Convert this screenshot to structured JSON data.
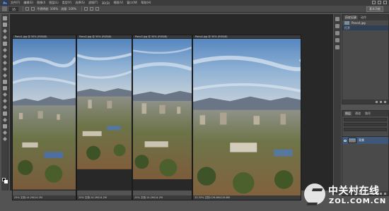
{
  "app": {
    "logo": "Ps"
  },
  "menu": {
    "items": [
      "文件(F)",
      "编辑(E)",
      "图像(I)",
      "图层(L)",
      "类型(Y)",
      "选择(S)",
      "滤镜(T)",
      "3D(D)",
      "视图(V)",
      "窗口(W)",
      "帮助(H)"
    ]
  },
  "options": {
    "size_value": "35",
    "mode_value": "不透明度: 100%",
    "flow_value": "流量: 100%",
    "right_button": "基本功能"
  },
  "documents": [
    {
      "tab": "Pano1.jpg @ 50% (RGB/8)",
      "zoom": "25%",
      "status": "文档:14.2M/14.2M"
    },
    {
      "tab": "Pano2.jpg @ 50% (RGB/8)",
      "zoom": "25%",
      "status": "文档:14.2M/14.2M"
    },
    {
      "tab": "Pano3.jpg @ 50% (RGB/8)",
      "zoom": "25%",
      "status": "文档:14.2M/14.2M"
    },
    {
      "tab": "Pano4.jpg @ 50% (RGB/8)",
      "zoom": "33.33%",
      "status": "文档:126.8M/126.8M"
    }
  ],
  "history_panel": {
    "tabs": [
      "历史记录",
      "动作"
    ],
    "snapshot": "Pano4.jpg",
    "step": "打开"
  },
  "layers_panel": {
    "tabs": [
      "图层",
      "通道",
      "路径"
    ],
    "layer_name": "背景"
  },
  "watermark": {
    "cn": "中关村在线",
    "en": "ZOL.COM.CN"
  },
  "colors": {
    "ui_dark": "#282828",
    "panel": "#4a4a4a",
    "accent": "#3f5778"
  }
}
